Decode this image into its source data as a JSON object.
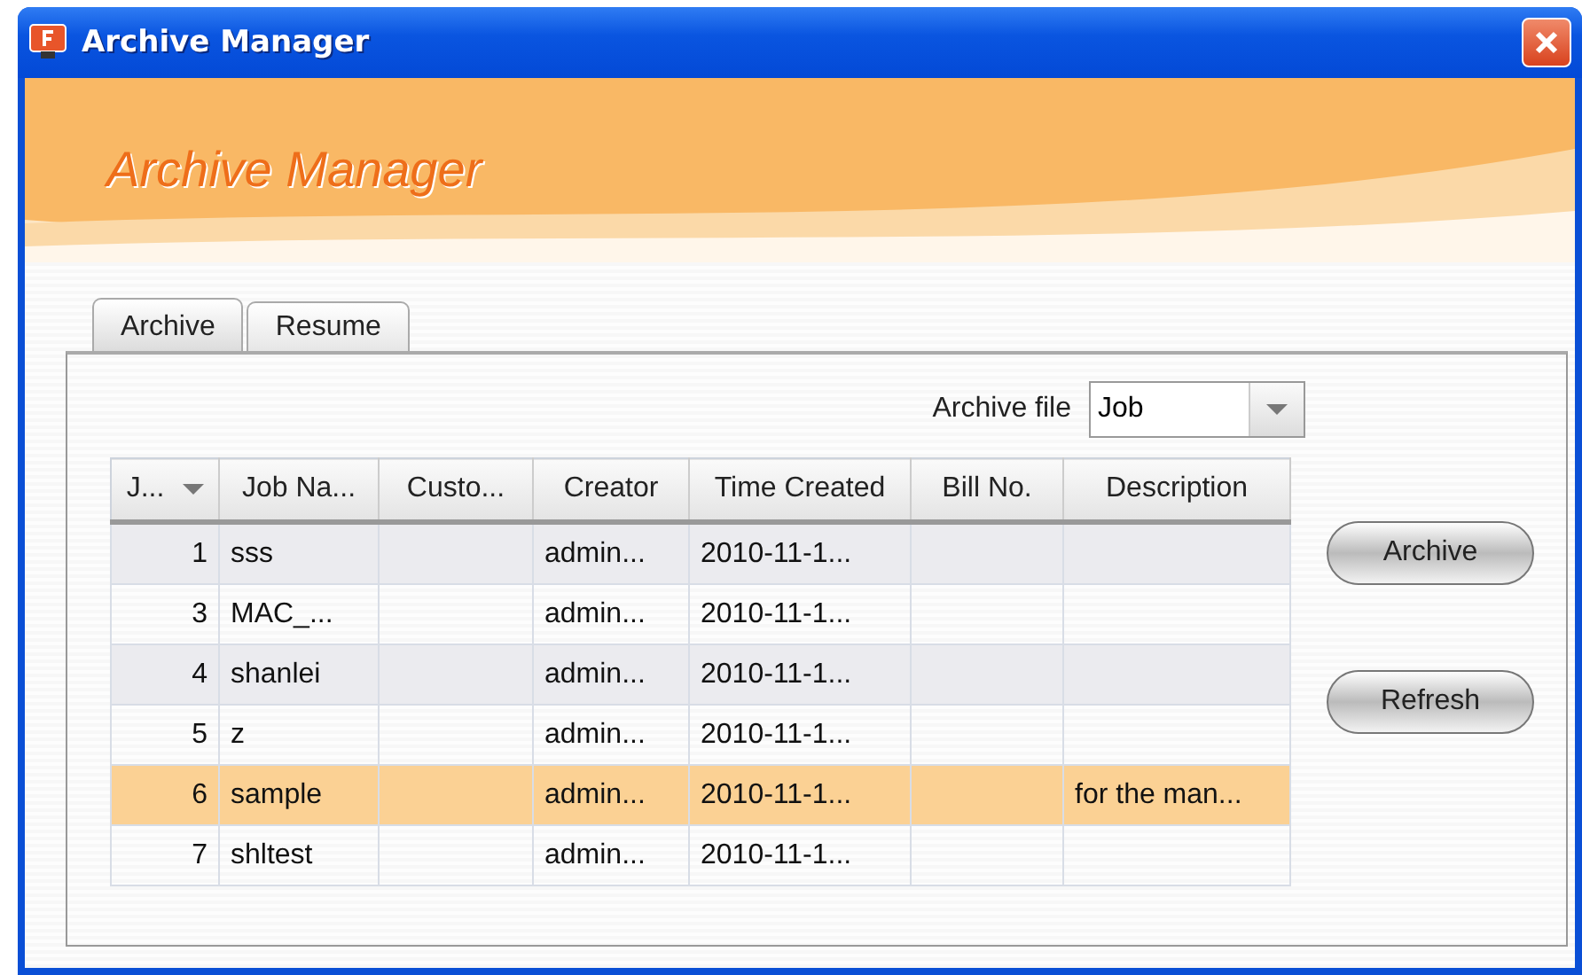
{
  "window": {
    "title": "Archive Manager"
  },
  "banner": {
    "title": "Archive Manager"
  },
  "tabs": [
    {
      "label": "Archive",
      "selected": true
    },
    {
      "label": "Resume",
      "selected": false
    }
  ],
  "archive_file": {
    "label": "Archive file",
    "value": "Job"
  },
  "table": {
    "columns": [
      {
        "label": "J...",
        "sorted": true
      },
      {
        "label": "Job Na...",
        "sorted": false
      },
      {
        "label": "Custo...",
        "sorted": false
      },
      {
        "label": "Creator",
        "sorted": false
      },
      {
        "label": "Time Created",
        "sorted": false
      },
      {
        "label": "Bill No.",
        "sorted": false
      },
      {
        "label": "Description",
        "sorted": false
      }
    ],
    "rows": [
      {
        "selected": false,
        "cells": [
          "1",
          "sss",
          "",
          "admin...",
          "2010-11-1...",
          "",
          ""
        ]
      },
      {
        "selected": false,
        "cells": [
          "3",
          "MAC_...",
          "",
          "admin...",
          "2010-11-1...",
          "",
          ""
        ]
      },
      {
        "selected": false,
        "cells": [
          "4",
          "shanlei",
          "",
          "admin...",
          "2010-11-1...",
          "",
          ""
        ]
      },
      {
        "selected": false,
        "cells": [
          "5",
          "z",
          "",
          "admin...",
          "2010-11-1...",
          "",
          ""
        ]
      },
      {
        "selected": true,
        "cells": [
          "6",
          "sample",
          "",
          "admin...",
          "2010-11-1...",
          "",
          "for the man..."
        ]
      },
      {
        "selected": false,
        "cells": [
          "7",
          "shltest",
          "",
          "admin...",
          "2010-11-1...",
          "",
          ""
        ]
      }
    ]
  },
  "buttons": [
    "Archive",
    "Refresh"
  ]
}
